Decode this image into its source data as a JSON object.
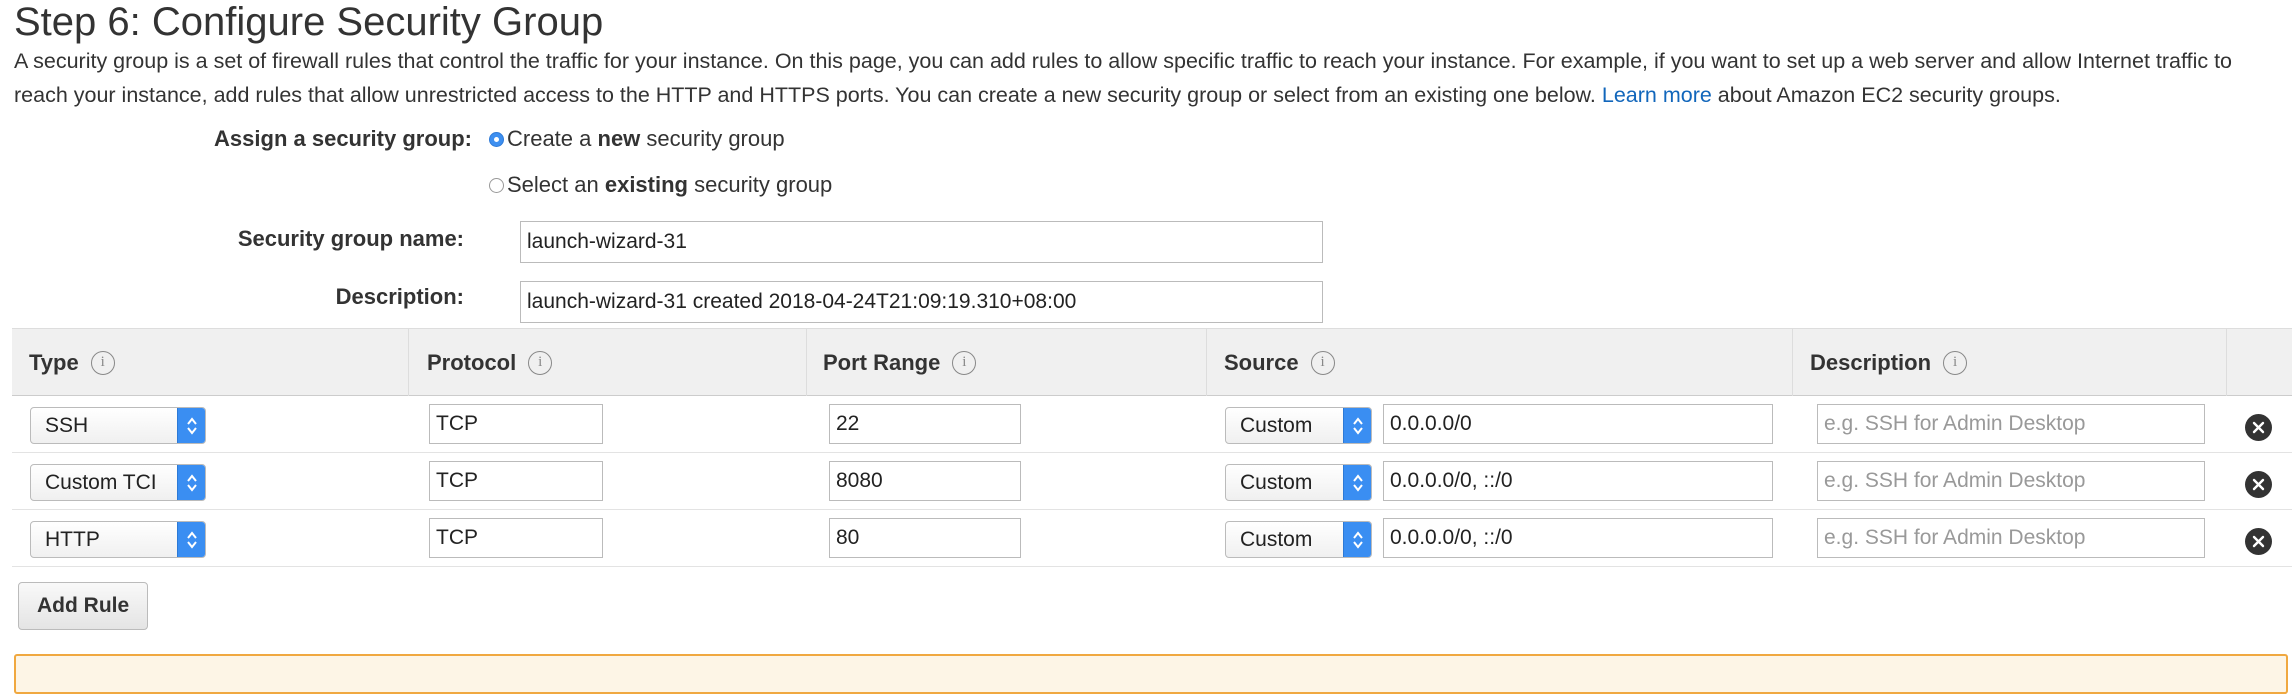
{
  "page": {
    "title": "Step 6: Configure Security Group",
    "intro_text": "A security group is a set of firewall rules that control the traffic for your instance. On this page, you can add rules to allow specific traffic to reach your instance. For example, if you want to set up a web server and allow Internet traffic to reach your instance, add rules that allow unrestricted access to the HTTP and HTTPS ports. You can create a new security group or select from an existing one below.",
    "learn_more": "Learn more",
    "intro_suffix": "about Amazon EC2 security groups."
  },
  "assign": {
    "label": "Assign a security group:",
    "option_new_prefix": "Create a ",
    "option_new_bold": "new",
    "option_new_suffix": " security group",
    "option_existing_prefix": "Select an ",
    "option_existing_bold": "existing",
    "option_existing_suffix": " security group",
    "selected": "new"
  },
  "form": {
    "name_label": "Security group name:",
    "name_value": "launch-wizard-31",
    "description_label": "Description:",
    "description_value": "launch-wizard-31 created 2018-04-24T21:09:19.310+08:00"
  },
  "table": {
    "headers": {
      "type": "Type",
      "protocol": "Protocol",
      "port_range": "Port Range",
      "source": "Source",
      "description": "Description"
    },
    "info_icon_glyph": "i",
    "rows": [
      {
        "type": "SSH",
        "protocol": "TCP",
        "port": "22",
        "source_type": "Custom",
        "source_value": "0.0.0.0/0",
        "description_placeholder": "e.g. SSH for Admin Desktop"
      },
      {
        "type": "Custom TCI",
        "protocol": "TCP",
        "port": "8080",
        "source_type": "Custom",
        "source_value": "0.0.0.0/0, ::/0",
        "description_placeholder": "e.g. SSH for Admin Desktop"
      },
      {
        "type": "HTTP",
        "protocol": "TCP",
        "port": "80",
        "source_type": "Custom",
        "source_value": "0.0.0.0/0, ::/0",
        "description_placeholder": "e.g. SSH for Admin Desktop"
      }
    ]
  },
  "actions": {
    "add_rule": "Add Rule"
  },
  "colors": {
    "link": "#1166bb",
    "select_accent": "#3a8ef2",
    "warning_border": "#f0a840"
  },
  "icons": {
    "info": "info-icon",
    "remove": "close-circle-icon",
    "select": "updown-arrows-icon"
  }
}
